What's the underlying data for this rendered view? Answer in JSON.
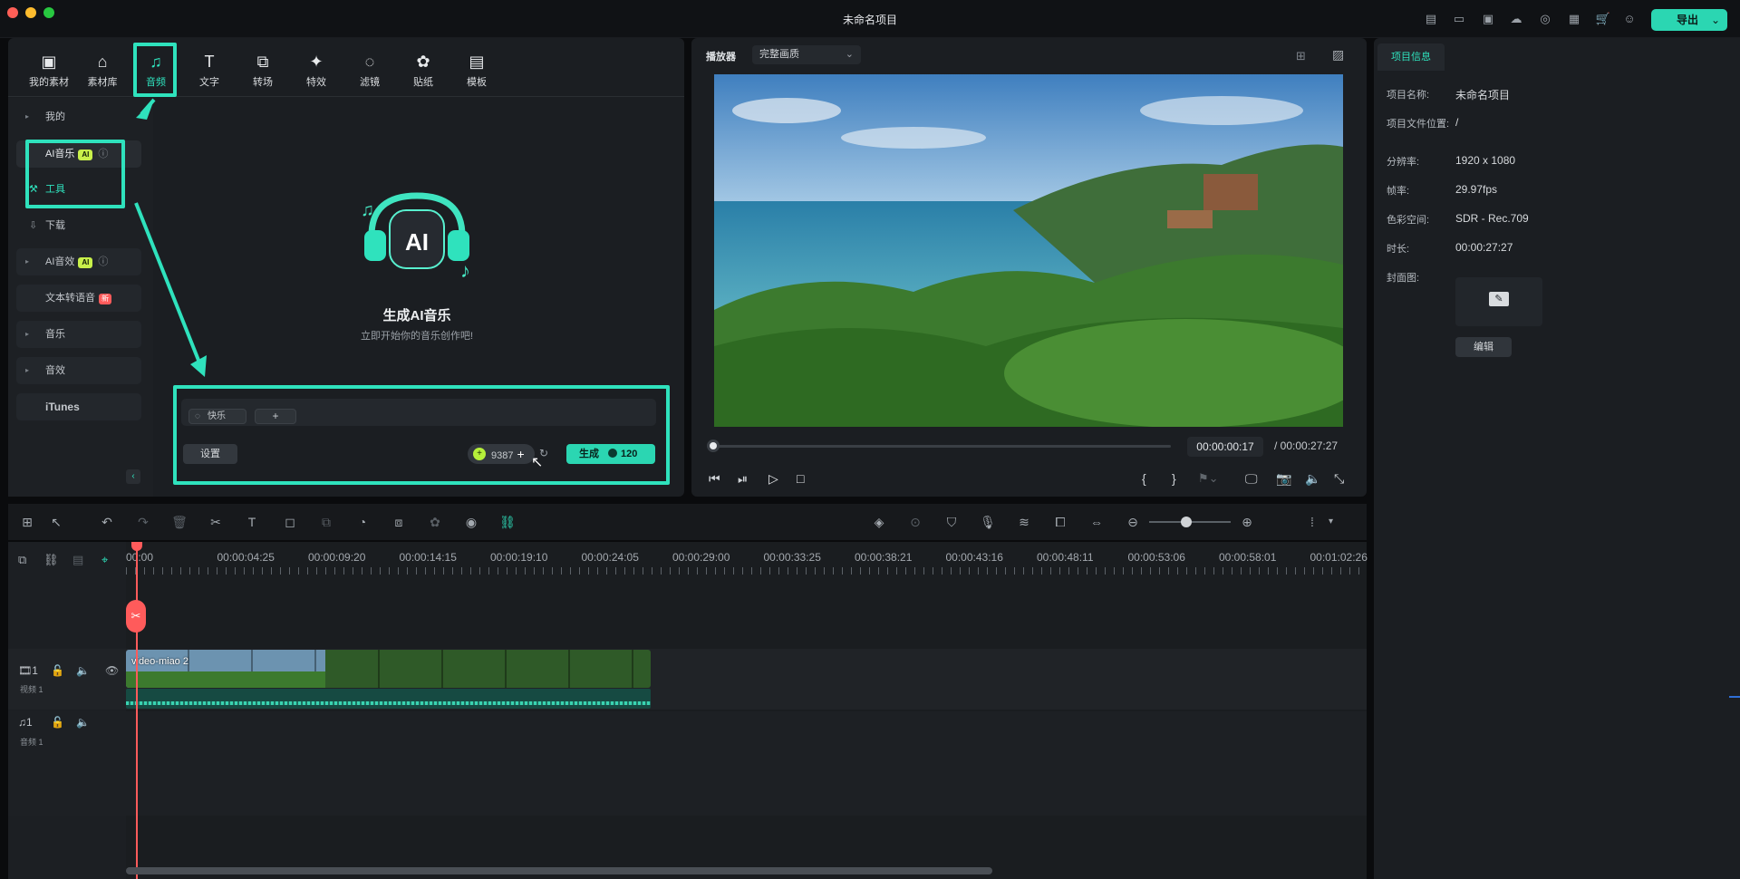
{
  "app": {
    "title": "未命名项目",
    "export_label": "导出"
  },
  "toolbar": [
    {
      "label": "我的素材",
      "icon": "media-icon"
    },
    {
      "label": "素材库",
      "icon": "store-icon"
    },
    {
      "label": "音频",
      "icon": "music-note-icon"
    },
    {
      "label": "文字",
      "icon": "text-icon"
    },
    {
      "label": "转场",
      "icon": "transition-icon"
    },
    {
      "label": "特效",
      "icon": "effects-icon"
    },
    {
      "label": "滤镜",
      "icon": "filter-icon"
    },
    {
      "label": "贴纸",
      "icon": "sticker-icon"
    },
    {
      "label": "模板",
      "icon": "template-icon"
    }
  ],
  "sidebar": {
    "mine": "我的",
    "ai_music": "AI音乐",
    "ai_badge": "AI",
    "tools": "工具",
    "download": "下载",
    "ai_sfx": "AI音效",
    "tts": "文本转语音",
    "new_badge": "新",
    "music": "音乐",
    "sfx": "音效",
    "itunes": "iTunes"
  },
  "ai_gen": {
    "title": "生成AI音乐",
    "subtitle": "立即开始你的音乐创作吧!",
    "logo_text": "AI",
    "tag": "快乐",
    "add": "+",
    "settings": "设置",
    "credits": "9387",
    "generate": "生成",
    "cost": "120"
  },
  "player": {
    "label": "播放器",
    "quality": "完整画质",
    "current_time": "00:00:00:17",
    "total_time": "/ 00:00:27:27",
    "progress": 0.01
  },
  "project": {
    "tab": "项目信息",
    "rows": [
      {
        "k": "项目名称:",
        "v": "未命名项目"
      },
      {
        "k": "项目文件位置:",
        "v": "/"
      },
      {
        "k": "分辨率:",
        "v": "1920 x 1080"
      },
      {
        "k": "帧率:",
        "v": "29.97fps"
      },
      {
        "k": "色彩空间:",
        "v": "SDR - Rec.709"
      },
      {
        "k": "时长:",
        "v": "00:00:27:27"
      },
      {
        "k": "封面图:",
        "v": ""
      }
    ],
    "edit": "编辑"
  },
  "timeline": {
    "ticks": [
      "00:00",
      "00:00:04:25",
      "00:00:09:20",
      "00:00:14:15",
      "00:00:19:10",
      "00:00:24:05",
      "00:00:29:00",
      "00:00:33:25",
      "00:00:38:21",
      "00:00:43:16",
      "00:00:48:11",
      "00:00:53:06",
      "00:00:58:01",
      "00:01:02:26"
    ],
    "video_track_num": "1",
    "video_track": "视频 1",
    "audio_track_num": "1",
    "audio_track": "音频 1",
    "clip_name": "video-miao 2"
  },
  "colors": {
    "accent": "#2fe2bd",
    "playhead": "#ff5b5b"
  }
}
